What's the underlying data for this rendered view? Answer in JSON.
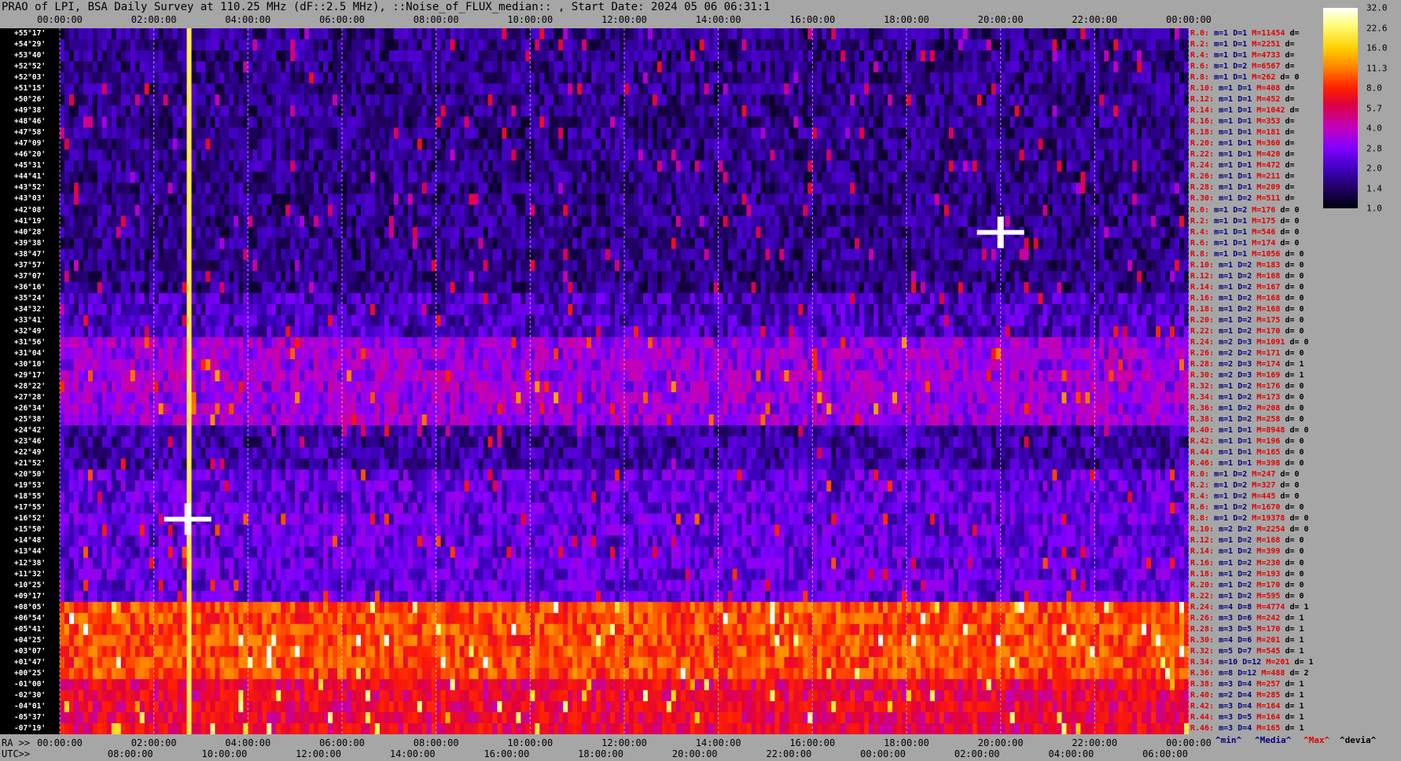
{
  "title": "PRAO of LPI, BSA Daily Survey at 110.25 MHz (dF::2.5 MHz), ::Noise_of_FLUX_median:: , Start Date: 2024 05 06 06:31:1",
  "top_axis": [
    "00:00:00",
    "02:00:00",
    "04:00:00",
    "06:00:00",
    "08:00:00",
    "10:00:00",
    "12:00:00",
    "14:00:00",
    "16:00:00",
    "18:00:00",
    "20:00:00",
    "22:00:00",
    "00:00:00"
  ],
  "bottom_axis_ra_prefix": "RA >>",
  "bottom_axis_ra": [
    "00:00:00",
    "02:00:00",
    "04:00:00",
    "06:00:00",
    "08:00:00",
    "10:00:00",
    "12:00:00",
    "14:00:00",
    "16:00:00",
    "18:00:00",
    "20:00:00",
    "22:00:00",
    "00:00:00"
  ],
  "bottom_axis_utc_prefix": "UTC>>",
  "bottom_axis_utc": [
    "08:00:00",
    "10:00:00",
    "12:00:00",
    "14:00:00",
    "16:00:00",
    "18:00:00",
    "20:00:00",
    "22:00:00",
    "00:00:00",
    "02:00:00",
    "04:00:00",
    "06:00:00"
  ],
  "colorbar": {
    "ticks": [
      "32.0",
      "22.6",
      "16.0",
      "11.3",
      "8.0",
      "5.7",
      "4.0",
      "2.8",
      "2.0",
      "1.4",
      "1.0"
    ]
  },
  "legend": {
    "min": "^min^",
    "median": "^Media^",
    "max": "^Max^",
    "devia": "^devia^"
  },
  "declinations": [
    "+55°17'",
    "+54°29'",
    "+53°40'",
    "+52°52'",
    "+52°03'",
    "+51°15'",
    "+50°26'",
    "+49°38'",
    "+48°46'",
    "+47°58'",
    "+47°09'",
    "+46°20'",
    "+45°31'",
    "+44°41'",
    "+43°52'",
    "+43°03'",
    "+42°08'",
    "+41°19'",
    "+40°28'",
    "+39°38'",
    "+38°47'",
    "+37°57'",
    "+37°07'",
    "+36°16'",
    "+35°24'",
    "+34°32'",
    "+33°41'",
    "+32°49'",
    "+31°56'",
    "+31°04'",
    "+30°10'",
    "+29°17'",
    "+28°22'",
    "+27°28'",
    "+26°34'",
    "+25°38'",
    "+24°42'",
    "+23°46'",
    "+22°49'",
    "+21°52'",
    "+20°50'",
    "+19°53'",
    "+18°55'",
    "+17°55'",
    "+16°52'",
    "+15°50'",
    "+14°48'",
    "+13°44'",
    "+12°38'",
    "+11°32'",
    "+10°25'",
    "+09°17'",
    "+08°05'",
    "+06°54'",
    "+05°41'",
    "+04°25'",
    "+03°07'",
    "+01°47'",
    "+00°25'",
    "-01°00'",
    "-02°30'",
    "-04°01'",
    "-05°37'",
    "-07°19'"
  ],
  "row_stats": [
    {
      "r": "R.0:",
      "m": "m=1",
      "d": "D=1",
      "mx": "M=11454",
      "dv": "d="
    },
    {
      "r": "R.2:",
      "m": "m=1",
      "d": "D=1",
      "mx": "M=2251",
      "dv": "d="
    },
    {
      "r": "R.4:",
      "m": "m=1",
      "d": "D=1",
      "mx": "M=4733",
      "dv": "d="
    },
    {
      "r": "R.6:",
      "m": "m=1",
      "d": "D=2",
      "mx": "M=6567",
      "dv": "d="
    },
    {
      "r": "R.8:",
      "m": "m=1",
      "d": "D=1",
      "mx": "M=262",
      "dv": "d= 0"
    },
    {
      "r": "R.10:",
      "m": "m=1",
      "d": "D=1",
      "mx": "M=408",
      "dv": "d="
    },
    {
      "r": "R.12:",
      "m": "m=1",
      "d": "D=1",
      "mx": "M=452",
      "dv": "d="
    },
    {
      "r": "R.14:",
      "m": "m=1",
      "d": "D=1",
      "mx": "M=1042",
      "dv": "d="
    },
    {
      "r": "R.16:",
      "m": "m=1",
      "d": "D=1",
      "mx": "M=353",
      "dv": "d="
    },
    {
      "r": "R.18:",
      "m": "m=1",
      "d": "D=1",
      "mx": "M=181",
      "dv": "d="
    },
    {
      "r": "R.20:",
      "m": "m=1",
      "d": "D=1",
      "mx": "M=360",
      "dv": "d="
    },
    {
      "r": "R.22:",
      "m": "m=1",
      "d": "D=1",
      "mx": "M=420",
      "dv": "d="
    },
    {
      "r": "R.24:",
      "m": "m=1",
      "d": "D=1",
      "mx": "M=472",
      "dv": "d="
    },
    {
      "r": "R.26:",
      "m": "m=1",
      "d": "D=1",
      "mx": "M=211",
      "dv": "d="
    },
    {
      "r": "R.28:",
      "m": "m=1",
      "d": "D=1",
      "mx": "M=209",
      "dv": "d="
    },
    {
      "r": "R.30:",
      "m": "m=1",
      "d": "D=2",
      "mx": "M=511",
      "dv": "d="
    },
    {
      "r": "R.0:",
      "m": "m=1",
      "d": "D=2",
      "mx": "M=176",
      "dv": "d= 0"
    },
    {
      "r": "R.2:",
      "m": "m=1",
      "d": "D=1",
      "mx": "M=175",
      "dv": "d= 0"
    },
    {
      "r": "R.4:",
      "m": "m=1",
      "d": "D=1",
      "mx": "M=546",
      "dv": "d= 0"
    },
    {
      "r": "R.6:",
      "m": "m=1",
      "d": "D=1",
      "mx": "M=174",
      "dv": "d= 0"
    },
    {
      "r": "R.8:",
      "m": "m=1",
      "d": "D=1",
      "mx": "M=1056",
      "dv": "d= 0"
    },
    {
      "r": "R.10:",
      "m": "m=1",
      "d": "D=2",
      "mx": "M=183",
      "dv": "d= 0"
    },
    {
      "r": "R.12:",
      "m": "m=1",
      "d": "D=2",
      "mx": "M=168",
      "dv": "d= 0"
    },
    {
      "r": "R.14:",
      "m": "m=1",
      "d": "D=2",
      "mx": "M=167",
      "dv": "d= 0"
    },
    {
      "r": "R.16:",
      "m": "m=1",
      "d": "D=2",
      "mx": "M=168",
      "dv": "d= 0"
    },
    {
      "r": "R.18:",
      "m": "m=1",
      "d": "D=2",
      "mx": "M=168",
      "dv": "d= 0"
    },
    {
      "r": "R.20:",
      "m": "m=1",
      "d": "D=2",
      "mx": "M=175",
      "dv": "d= 0"
    },
    {
      "r": "R.22:",
      "m": "m=1",
      "d": "D=2",
      "mx": "M=170",
      "dv": "d= 0"
    },
    {
      "r": "R.24:",
      "m": "m=2",
      "d": "D=3",
      "mx": "M=1091",
      "dv": "d= 0"
    },
    {
      "r": "R.26:",
      "m": "m=2",
      "d": "D=2",
      "mx": "M=171",
      "dv": "d= 0"
    },
    {
      "r": "R.28:",
      "m": "m=2",
      "d": "D=3",
      "mx": "M=174",
      "dv": "d= 1"
    },
    {
      "r": "R.30:",
      "m": "m=2",
      "d": "D=3",
      "mx": "M=169",
      "dv": "d= 1"
    },
    {
      "r": "R.32:",
      "m": "m=1",
      "d": "D=2",
      "mx": "M=176",
      "dv": "d= 0"
    },
    {
      "r": "R.34:",
      "m": "m=1",
      "d": "D=2",
      "mx": "M=173",
      "dv": "d= 0"
    },
    {
      "r": "R.36:",
      "m": "m=1",
      "d": "D=2",
      "mx": "M=208",
      "dv": "d= 0"
    },
    {
      "r": "R.38:",
      "m": "m=1",
      "d": "D=2",
      "mx": "M=258",
      "dv": "d= 0"
    },
    {
      "r": "R.40:",
      "m": "m=1",
      "d": "D=1",
      "mx": "M=8948",
      "dv": "d= 0"
    },
    {
      "r": "R.42:",
      "m": "m=1",
      "d": "D=1",
      "mx": "M=196",
      "dv": "d= 0"
    },
    {
      "r": "R.44:",
      "m": "m=1",
      "d": "D=1",
      "mx": "M=165",
      "dv": "d= 0"
    },
    {
      "r": "R.46:",
      "m": "m=1",
      "d": "D=1",
      "mx": "M=398",
      "dv": "d= 0"
    },
    {
      "r": "R.0:",
      "m": "m=1",
      "d": "D=2",
      "mx": "M=247",
      "dv": "d= 0"
    },
    {
      "r": "R.2:",
      "m": "m=1",
      "d": "D=2",
      "mx": "M=327",
      "dv": "d= 0"
    },
    {
      "r": "R.4:",
      "m": "m=1",
      "d": "D=2",
      "mx": "M=445",
      "dv": "d= 0"
    },
    {
      "r": "R.6:",
      "m": "m=1",
      "d": "D=2",
      "mx": "M=1670",
      "dv": "d= 0"
    },
    {
      "r": "R.8:",
      "m": "m=1",
      "d": "D=2",
      "mx": "M=19378",
      "dv": "d= 0"
    },
    {
      "r": "R.10:",
      "m": "m=2",
      "d": "D=2",
      "mx": "M=2254",
      "dv": "d= 0"
    },
    {
      "r": "R.12:",
      "m": "m=1",
      "d": "D=2",
      "mx": "M=168",
      "dv": "d= 0"
    },
    {
      "r": "R.14:",
      "m": "m=1",
      "d": "D=2",
      "mx": "M=399",
      "dv": "d= 0"
    },
    {
      "r": "R.16:",
      "m": "m=1",
      "d": "D=2",
      "mx": "M=230",
      "dv": "d= 0"
    },
    {
      "r": "R.18:",
      "m": "m=1",
      "d": "D=2",
      "mx": "M=193",
      "dv": "d= 0"
    },
    {
      "r": "R.20:",
      "m": "m=1",
      "d": "D=2",
      "mx": "M=170",
      "dv": "d= 0"
    },
    {
      "r": "R.22:",
      "m": "m=1",
      "d": "D=2",
      "mx": "M=595",
      "dv": "d= 0"
    },
    {
      "r": "R.24:",
      "m": "m=4",
      "d": "D=8",
      "mx": "M=4774",
      "dv": "d= 1"
    },
    {
      "r": "R.26:",
      "m": "m=3",
      "d": "D=6",
      "mx": "M=242",
      "dv": "d= 1"
    },
    {
      "r": "R.28:",
      "m": "m=3",
      "d": "D=5",
      "mx": "M=170",
      "dv": "d= 1"
    },
    {
      "r": "R.30:",
      "m": "m=4",
      "d": "D=6",
      "mx": "M=201",
      "dv": "d= 1"
    },
    {
      "r": "R.32:",
      "m": "m=5",
      "d": "D=7",
      "mx": "M=545",
      "dv": "d= 1"
    },
    {
      "r": "R.34:",
      "m": "m=10",
      "d": "D=12",
      "mx": "M=201",
      "dv": "d= 1"
    },
    {
      "r": "R.36:",
      "m": "m=8",
      "d": "D=12",
      "mx": "M=488",
      "dv": "d= 2"
    },
    {
      "r": "R.38:",
      "m": "m=3",
      "d": "D=4",
      "mx": "M=257",
      "dv": "d= 1"
    },
    {
      "r": "R.40:",
      "m": "m=2",
      "d": "D=4",
      "mx": "M=285",
      "dv": "d= 1"
    },
    {
      "r": "R.42:",
      "m": "m=3",
      "d": "D=4",
      "mx": "M=164",
      "dv": "d= 1"
    },
    {
      "r": "R.44:",
      "m": "m=3",
      "d": "D=5",
      "mx": "M=164",
      "dv": "d= 1"
    },
    {
      "r": "R.46:",
      "m": "m=3",
      "d": "D=4",
      "mx": "M=165",
      "dv": "d= 1"
    }
  ],
  "chart_data": {
    "type": "heatmap",
    "x_hours": [
      0,
      24
    ],
    "bands": [
      {
        "rows": [
          0,
          23
        ],
        "level": 1.6
      },
      {
        "rows": [
          24,
          27
        ],
        "level": 2.0
      },
      {
        "rows": [
          28,
          35
        ],
        "level": 3.2
      },
      {
        "rows": [
          36,
          39
        ],
        "level": 1.8
      },
      {
        "rows": [
          40,
          51
        ],
        "level": 2.4
      },
      {
        "rows": [
          52,
          58
        ],
        "level": 9.0
      },
      {
        "rows": [
          59,
          63
        ],
        "level": 6.0
      }
    ],
    "tracks": [
      {
        "name": "",
        "ra_hours": [
          2.75,
          2.75
        ],
        "level": 20
      }
    ],
    "spots": [
      {
        "ra_h": 2.72,
        "row": 44,
        "level": 32
      },
      {
        "ra_h": 20.0,
        "row": 18,
        "level": 32
      }
    ]
  }
}
